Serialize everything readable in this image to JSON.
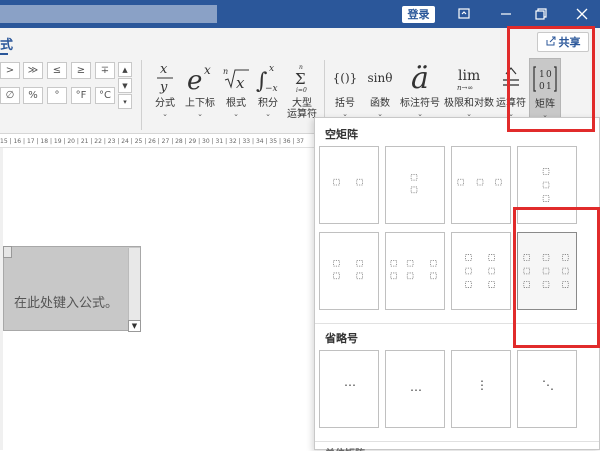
{
  "titlebar": {
    "login_label": "登录"
  },
  "ribbon": {
    "tab_label": "式",
    "share_label": "共享",
    "symbols": [
      ">",
      "≫",
      "≤",
      "≥",
      "∓",
      "∅",
      "%",
      "°",
      "°F",
      "°C"
    ],
    "tools": [
      {
        "name": "fraction",
        "label": "分式"
      },
      {
        "name": "script",
        "label": "上下标"
      },
      {
        "name": "radical",
        "label": "根式"
      },
      {
        "name": "integral",
        "label": "积分"
      },
      {
        "name": "large-operator",
        "label": "大型\n运算符"
      },
      {
        "name": "bracket",
        "label": "括号"
      },
      {
        "name": "function",
        "label": "函数",
        "glyph": "sinθ"
      },
      {
        "name": "accent",
        "label": "标注符号"
      },
      {
        "name": "limit-log",
        "label": "极限和对数",
        "glyph": "lim"
      },
      {
        "name": "operator",
        "label": "运算符"
      },
      {
        "name": "matrix",
        "label": "矩阵"
      }
    ]
  },
  "ruler": {
    "text": "15 | 16 | 17 | 18 | 19 | 20 | 21 | 22 | 23 | 24 | 25 | 26 | 27 | 28 | 29 | 30 | 31 | 32 | 33 | 34 | 35 | 36 | 37"
  },
  "document": {
    "equation_placeholder": "在此处键入公式。"
  },
  "matrix_panel": {
    "section_empty": "空矩阵",
    "section_dots": "省略号",
    "section_next_partial": "单位矩阵",
    "dots_tiles": [
      "⋯",
      "…",
      "⋮",
      "⋱"
    ]
  },
  "colors": {
    "accent": "#2b579a",
    "highlight": "#e12b2b"
  }
}
